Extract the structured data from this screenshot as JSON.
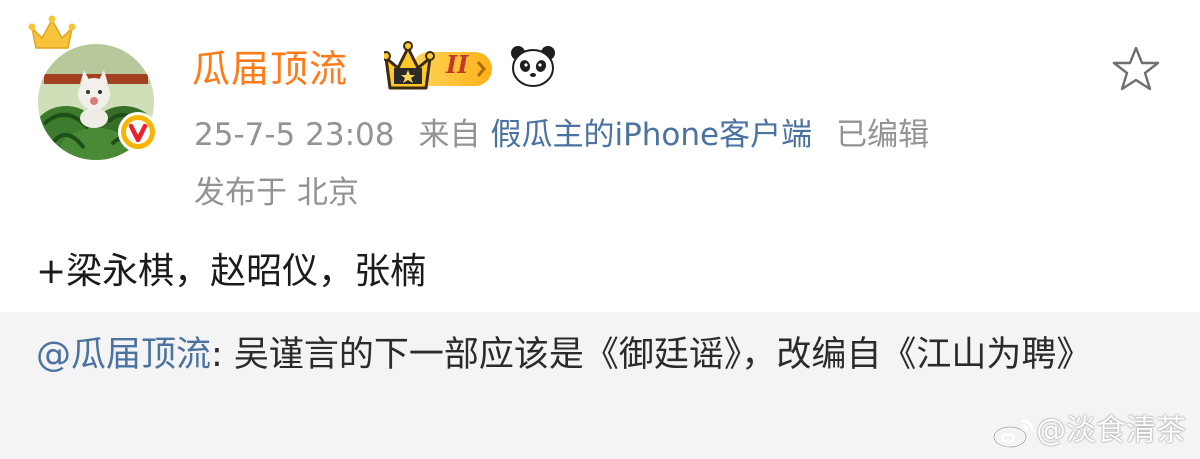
{
  "post": {
    "author_name": "瓜届顶流",
    "vip_level": "II",
    "timestamp": "25-7-5 23:08",
    "from_label": "来自",
    "source": "假瓜主的iPhone客户端",
    "edited": "已编辑",
    "location": "发布于 北京",
    "content": "+梁永棋，赵昭仪，张楠"
  },
  "repost": {
    "mention": "@瓜届顶流",
    "text": ": 吴谨言的下一部应该是《御廷谣》，改编自《江山为聘》"
  },
  "watermark": {
    "text": "@淡食清茶"
  },
  "colors": {
    "name": "#ff7b1a",
    "link": "#4b72a0",
    "meta": "#939393",
    "repost_bg": "#f4f4f4"
  },
  "icons": {
    "crown": "crown-icon",
    "verified": "verified-v-icon",
    "vip": "vip-crown-badge-icon",
    "panda": "panda-icon",
    "favorite": "star-outline-icon",
    "weibo": "weibo-logo-icon"
  }
}
